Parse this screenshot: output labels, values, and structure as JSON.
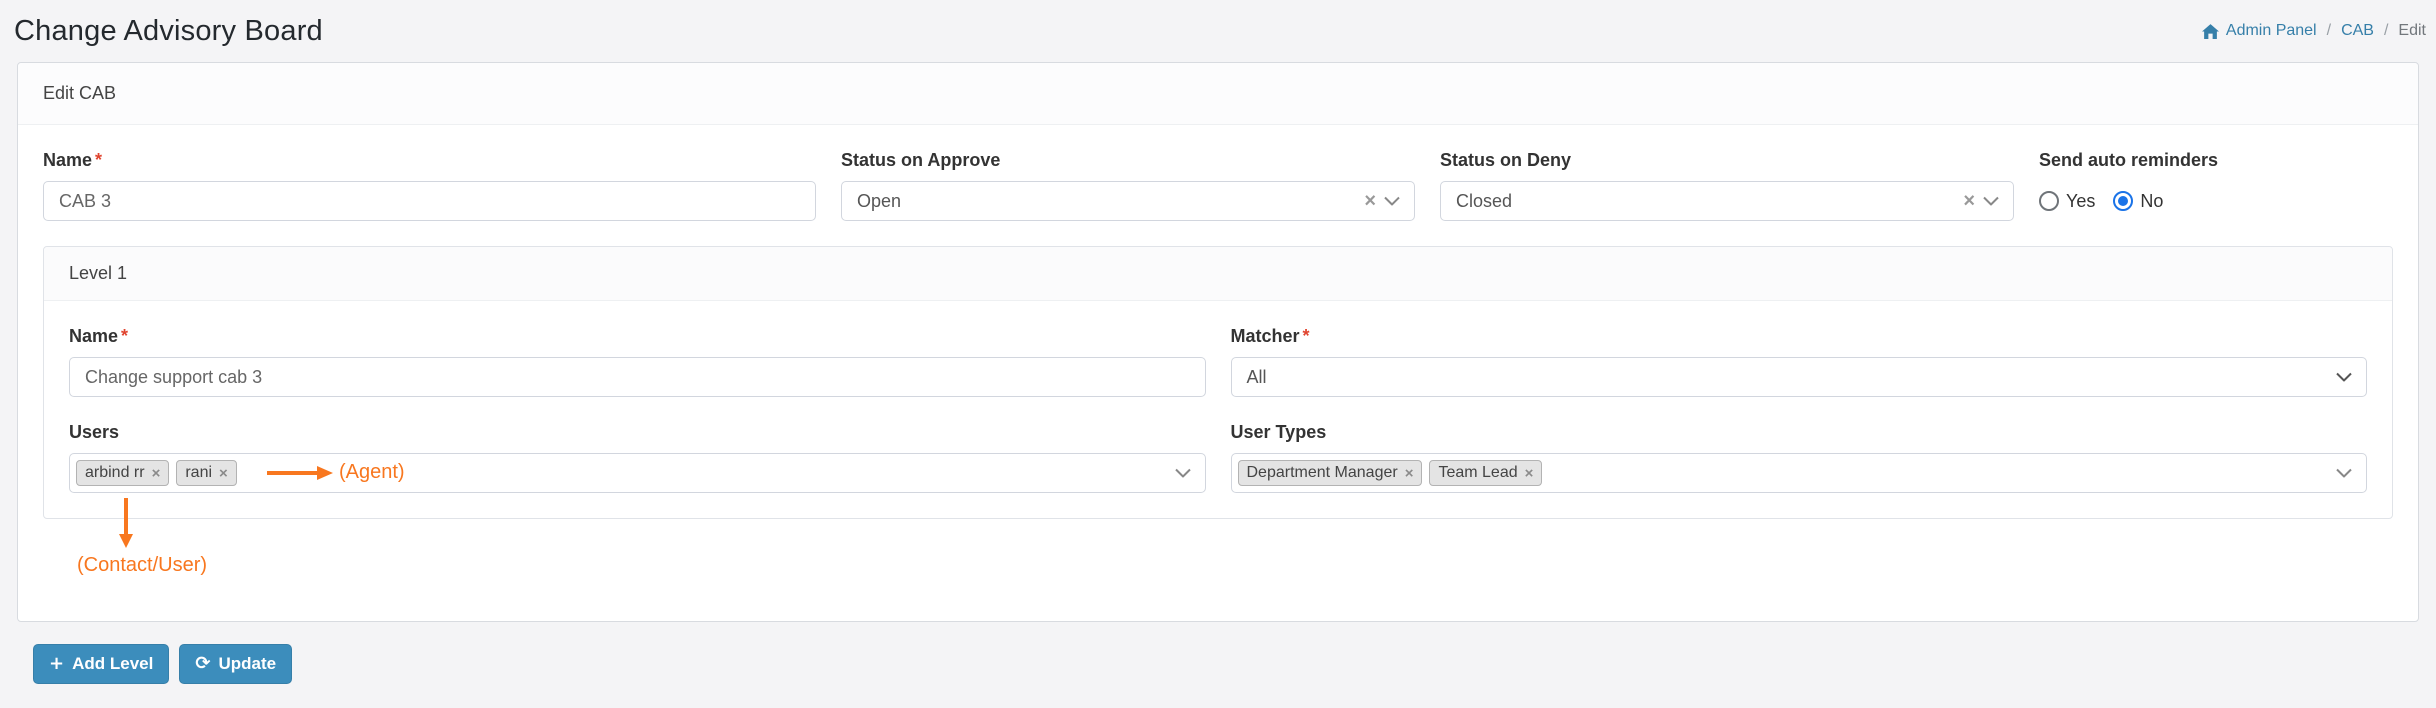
{
  "page": {
    "title": "Change Advisory Board",
    "breadcrumb": {
      "separator": "/",
      "items": [
        {
          "label": "Admin Panel"
        },
        {
          "label": "CAB"
        },
        {
          "label": "Edit"
        }
      ]
    }
  },
  "icons": {
    "plus": "+",
    "refresh": "⟳",
    "clear": "×",
    "tag_remove": "×",
    "home": "home-icon",
    "chevron": "chevron-down-icon"
  },
  "card": {
    "header": "Edit CAB",
    "required_mark": "*",
    "fields": {
      "name": {
        "label": "Name",
        "required": true,
        "value": "CAB 3"
      },
      "status_on_approve": {
        "label": "Status on Approve",
        "value": "Open",
        "clearable": true
      },
      "status_on_deny": {
        "label": "Status on Deny",
        "value": "Closed",
        "clearable": true
      },
      "send_auto_reminders": {
        "label": "Send auto reminders",
        "options": [
          {
            "label": "Yes",
            "selected": false
          },
          {
            "label": "No",
            "selected": true
          }
        ]
      }
    },
    "level": {
      "header": "Level 1",
      "name": {
        "label": "Name",
        "required": true,
        "value": "Change support cab 3"
      },
      "matcher": {
        "label": "Matcher",
        "required": true,
        "value": "All"
      },
      "users": {
        "label": "Users",
        "tags": [
          "arbind rr",
          "rani"
        ]
      },
      "user_types": {
        "label": "User Types",
        "tags": [
          "Department Manager",
          "Team Lead"
        ]
      }
    }
  },
  "annotations": {
    "color": "#f8771f",
    "agent_label": "(Agent)",
    "contact_user_label": "(Contact/User)"
  },
  "footer": {
    "add_level_label": "Add Level",
    "update_label": "Update"
  },
  "colors": {
    "primary_button": "#3c8dbc",
    "primary_button_border": "#367fa9",
    "link": "#367fa9",
    "required": "#e0442f",
    "radio_checked": "#1a73e8"
  }
}
